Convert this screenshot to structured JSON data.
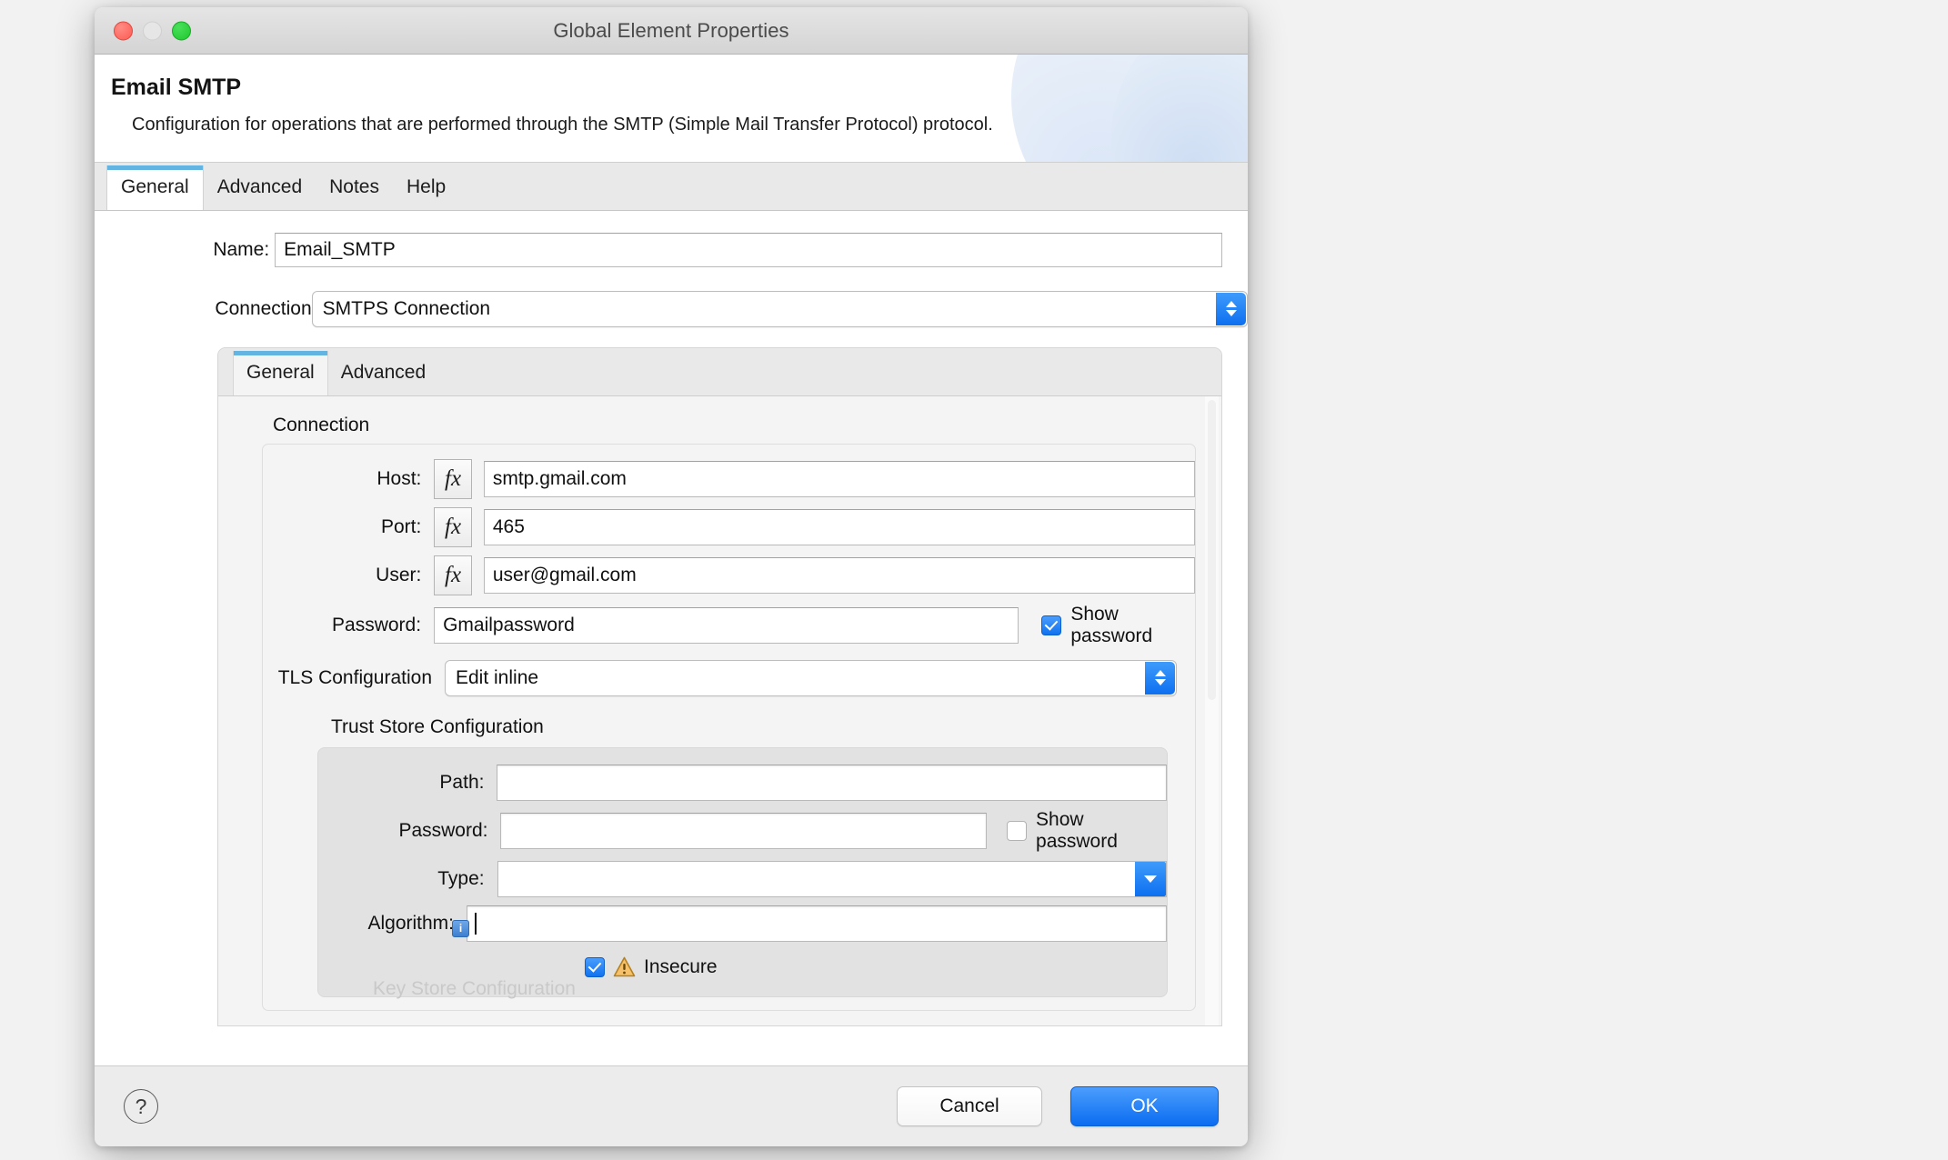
{
  "window": {
    "title": "Global Element Properties",
    "traffic_lights": [
      "close",
      "minimize",
      "maximize"
    ]
  },
  "banner": {
    "title": "Email SMTP",
    "description": "Configuration for operations that are performed through the SMTP (Simple Mail Transfer Protocol) protocol."
  },
  "tabs": [
    {
      "label": "General",
      "active": true
    },
    {
      "label": "Advanced",
      "active": false
    },
    {
      "label": "Notes",
      "active": false
    },
    {
      "label": "Help",
      "active": false
    }
  ],
  "form": {
    "name_label": "Name:",
    "name_value": "Email_SMTP",
    "connection_label": "Connection",
    "connection_value": "SMTPS Connection"
  },
  "inner_tabs": [
    {
      "label": "General",
      "active": true
    },
    {
      "label": "Advanced",
      "active": false
    }
  ],
  "connection_group": {
    "title": "Connection",
    "host_label": "Host:",
    "host_value": "smtp.gmail.com",
    "port_label": "Port:",
    "port_value": "465",
    "user_label": "User:",
    "user_value": "user@gmail.com",
    "fx_label": "fx",
    "password_label": "Password:",
    "password_value": "Gmailpassword",
    "show_password_label": "Show password",
    "show_password_checked": true,
    "tls_label": "TLS Configuration",
    "tls_value": "Edit inline"
  },
  "trust_store": {
    "title": "Trust Store Configuration",
    "path_label": "Path:",
    "path_value": "",
    "password_label": "Password:",
    "password_value": "",
    "show_password_label": "Show password",
    "show_password_checked": false,
    "type_label": "Type:",
    "type_value": "",
    "algorithm_label": "Algorithm:",
    "algorithm_value": "",
    "info_badge": "i",
    "insecure_label": "Insecure",
    "insecure_checked": true
  },
  "peek": {
    "next_section": "Key Store Configuration"
  },
  "footer": {
    "help_label": "?",
    "cancel_label": "Cancel",
    "ok_label": "OK"
  },
  "colors": {
    "accent_blue": "#0d6ff0",
    "tab_indicator": "#63b4e0",
    "warning_amber": "#f0b445"
  }
}
